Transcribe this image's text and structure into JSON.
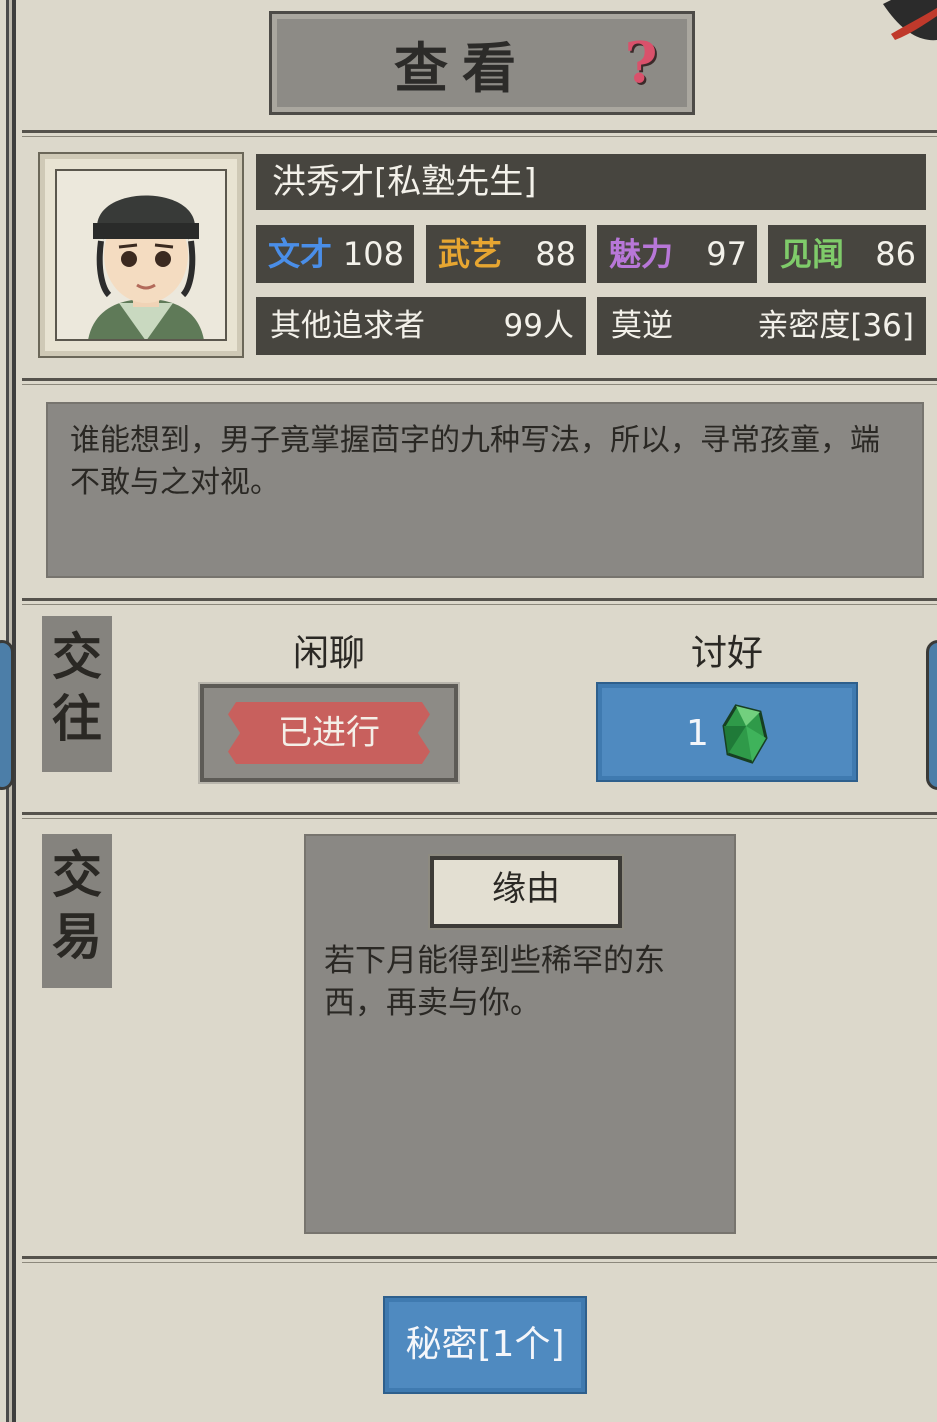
{
  "header": {
    "title": "查看",
    "help_icon": "question-mark-icon",
    "help_glyph": "?"
  },
  "profile": {
    "name": "洪秀才[私塾先生]",
    "stats": [
      {
        "label": "文才",
        "value": "108",
        "color": "#4a8ee8"
      },
      {
        "label": "武艺",
        "value": "88",
        "color": "#e7a631"
      },
      {
        "label": "魅力",
        "value": "97",
        "color": "#b877d8"
      },
      {
        "label": "见闻",
        "value": "86",
        "color": "#7fcb6a"
      }
    ],
    "suitors_label": "其他追求者",
    "suitors_value": "99人",
    "relation_label": "莫逆",
    "intimacy": "亲密度[36]"
  },
  "description": "谁能想到，男子竟掌握茴字的九种写法，所以，寻常孩童，端不敢与之对视。",
  "interaction": {
    "tab_label": [
      "交",
      "往"
    ],
    "chat_label": "闲聊",
    "chat_status": "已进行",
    "please_label": "讨好",
    "please_cost": "1",
    "please_icon": "green-gem-icon"
  },
  "trade": {
    "tab_label": [
      "交",
      "易"
    ],
    "reason_label": "缘由",
    "reason_text": "若下月能得到些稀罕的东西，再卖与你。"
  },
  "footer": {
    "secret_button": "秘密[1个]"
  }
}
